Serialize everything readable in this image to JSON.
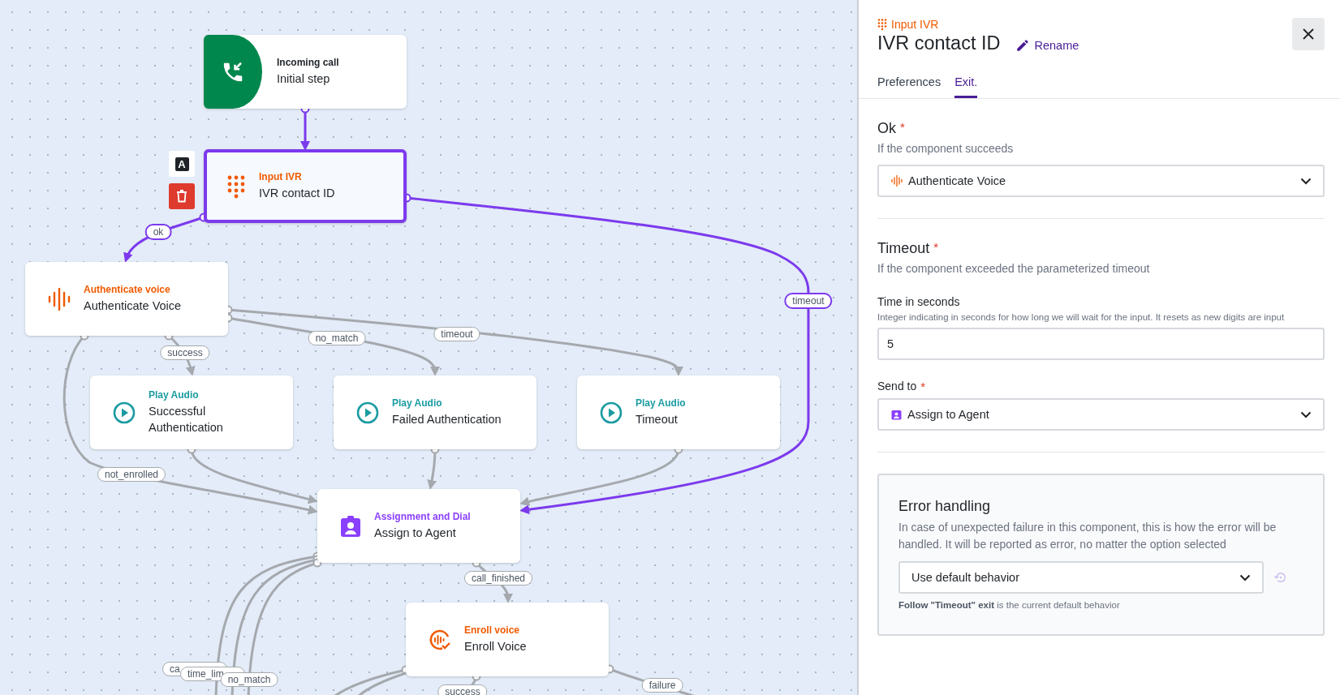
{
  "canvas": {
    "nodes": [
      {
        "kind": "start",
        "category": "Incoming call",
        "name": "Initial step",
        "selected": false
      },
      {
        "kind": "ivr",
        "category": "Input IVR",
        "name": "IVR contact ID",
        "selected": true
      },
      {
        "kind": "voice",
        "category": "Authenticate voice",
        "name": "Authenticate Voice",
        "selected": false
      },
      {
        "kind": "audio",
        "category": "Play Audio",
        "name": "Successful Authentication",
        "selected": false
      },
      {
        "kind": "audio",
        "category": "Play Audio",
        "name": "Failed Authentication",
        "selected": false
      },
      {
        "kind": "audio",
        "category": "Play Audio",
        "name": "Timeout",
        "selected": false
      },
      {
        "kind": "assign",
        "category": "Assignment and Dial",
        "name": "Assign to Agent",
        "selected": false
      },
      {
        "kind": "enroll",
        "category": "Enroll voice",
        "name": "Enroll Voice",
        "selected": false
      }
    ],
    "node_actions": [
      {
        "kind": "rename",
        "label": "A"
      },
      {
        "kind": "delete"
      }
    ],
    "edge_labels": [
      {
        "label": "ok"
      },
      {
        "label": "timeout"
      },
      {
        "label": "no_match"
      },
      {
        "label": "timeout"
      },
      {
        "label": "success"
      },
      {
        "label": "not_enrolled"
      },
      {
        "label": "call_finished"
      },
      {
        "label": "ca"
      },
      {
        "label": "time_lim"
      },
      {
        "label": "no_match"
      },
      {
        "label": "success"
      },
      {
        "label": "failure"
      }
    ]
  },
  "panel": {
    "category": "Input IVR",
    "title": "IVR contact ID",
    "rename": "Rename",
    "tabs": [
      {
        "label": "Preferences",
        "selected": false
      },
      {
        "label": "Exit.",
        "selected": true
      }
    ],
    "ok": {
      "title": "Ok",
      "required_mark": "*",
      "description": "If the component succeeds",
      "select": {
        "kind": "voice",
        "value": "Authenticate Voice"
      }
    },
    "timeout": {
      "title": "Timeout",
      "required_mark": "*",
      "description": "If the component exceeded the parameterized timeout",
      "time_field": {
        "label": "Time in seconds",
        "help": "Integer indicating in seconds for how long we will wait for the input. It resets as new digits are input",
        "value": "5"
      },
      "send_to": {
        "label": "Send to",
        "required_mark": "*",
        "select": {
          "kind": "assign",
          "value": "Assign to Agent"
        }
      }
    },
    "error_handling": {
      "title": "Error handling",
      "description": "In case of unexpected failure in this component, this is how the error will be handled. It will be reported as error, no matter the option selected",
      "select": {
        "value": "Use default behavior"
      },
      "reset_disabled": true,
      "note": "**Follow \"Timeout\" exit** is the current default behavior"
    }
  }
}
